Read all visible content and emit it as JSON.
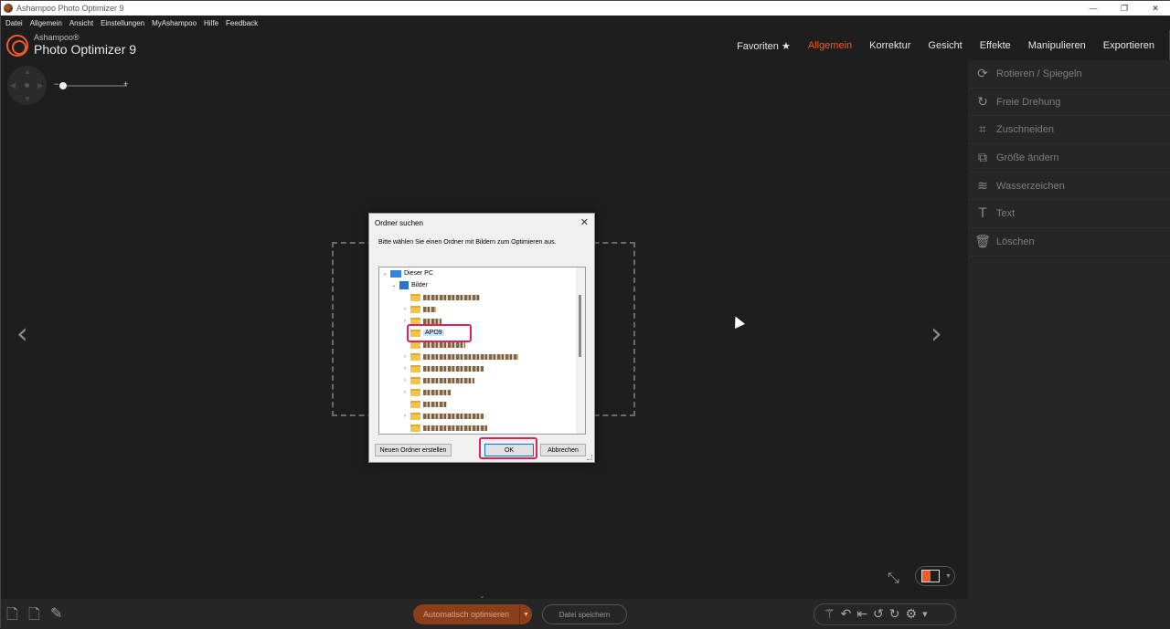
{
  "window": {
    "title": "Ashampoo Photo Optimizer 9",
    "controls": [
      "—",
      "❐",
      "✕"
    ]
  },
  "menu": [
    "Datei",
    "Allgemein",
    "Ansicht",
    "Einstellungen",
    "MyAshampoo",
    "Hilfe",
    "Feedback"
  ],
  "logo": {
    "brand": "Ashampoo®",
    "product": "Photo Optimizer 9"
  },
  "topnav": {
    "items": [
      "Favoriten ★",
      "Allgemein",
      "Korrektur",
      "Gesicht",
      "Effekte",
      "Manipulieren",
      "Exportieren"
    ],
    "active": "Allgemein",
    "accent": "#f05a28"
  },
  "zoom": {
    "minus": "−",
    "plus": "+",
    "level": 0.0
  },
  "panel": {
    "items": [
      {
        "label": "Rotieren / Spiegeln",
        "icon": "rotate-flip-icon",
        "glyph": "⟳"
      },
      {
        "label": "Freie Drehung",
        "icon": "free-rotate-icon",
        "glyph": "↻"
      },
      {
        "label": "Zuschneiden",
        "icon": "crop-icon",
        "glyph": "⌗"
      },
      {
        "label": "Größe ändern",
        "icon": "resize-icon",
        "glyph": "⧉"
      },
      {
        "label": "Wasserzeichen",
        "icon": "watermark-icon",
        "glyph": "≋"
      },
      {
        "label": "Text",
        "icon": "text-icon",
        "glyph": "T"
      },
      {
        "label": "Löschen",
        "icon": "delete-icon",
        "glyph": "🗑"
      }
    ]
  },
  "bottom": {
    "auto_optimize": "Automatisch optimieren",
    "save_file": "Datei speichern"
  },
  "dialog": {
    "title": "Ordner suchen",
    "close": "✕",
    "message": "Bitte wählen Sie einen Ordner mit Bildern zum Optimieren aus.",
    "tree": {
      "root": "Dieser PC",
      "pictures": "Bilder",
      "selected": "APO9"
    },
    "new_folder": "Neuen Ordner erstellen",
    "ok": "OK",
    "cancel": "Abbrechen"
  }
}
